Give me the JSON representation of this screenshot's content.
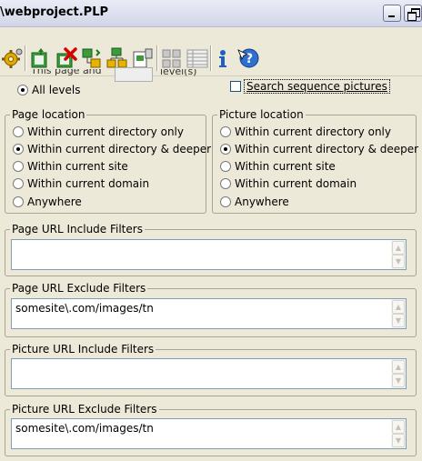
{
  "window": {
    "title": "\\webproject.PLP"
  },
  "toolbar": {
    "buttons": [
      "gear-icon",
      "add-page-icon",
      "delete-page-icon",
      "tree-add-icon",
      "tree-move-icon",
      "page-properties-icon",
      "thumbnail-view-icon",
      "detail-view-icon",
      "info-icon",
      "help-icon"
    ]
  },
  "levels": {
    "partial_label": "This page and",
    "partial_suffix": "level(s)",
    "all_levels_label": "All levels",
    "all_levels_selected": true
  },
  "search_sequence": {
    "label": "Search sequence pictures",
    "checked": false
  },
  "page_location": {
    "title": "Page location",
    "options": [
      {
        "label": "Within current directory only",
        "selected": false
      },
      {
        "label": "Within current directory & deeper",
        "selected": true
      },
      {
        "label": "Within current site",
        "selected": false
      },
      {
        "label": "Within current domain",
        "selected": false
      },
      {
        "label": "Anywhere",
        "selected": false
      }
    ]
  },
  "picture_location": {
    "title": "Picture location",
    "options": [
      {
        "label": "Within current directory only",
        "selected": false
      },
      {
        "label": "Within current directory & deeper",
        "selected": true
      },
      {
        "label": "Within current site",
        "selected": false
      },
      {
        "label": "Within current domain",
        "selected": false
      },
      {
        "label": "Anywhere",
        "selected": false
      }
    ]
  },
  "filters": {
    "page_include": {
      "title": "Page URL Include Filters",
      "value": ""
    },
    "page_exclude": {
      "title": "Page URL Exclude Filters",
      "value": "somesite\\.com/images/tn"
    },
    "picture_include": {
      "title": "Picture URL Include Filters",
      "value": ""
    },
    "picture_exclude": {
      "title": "Picture URL Exclude Filters",
      "value": "somesite\\.com/images/tn"
    }
  }
}
